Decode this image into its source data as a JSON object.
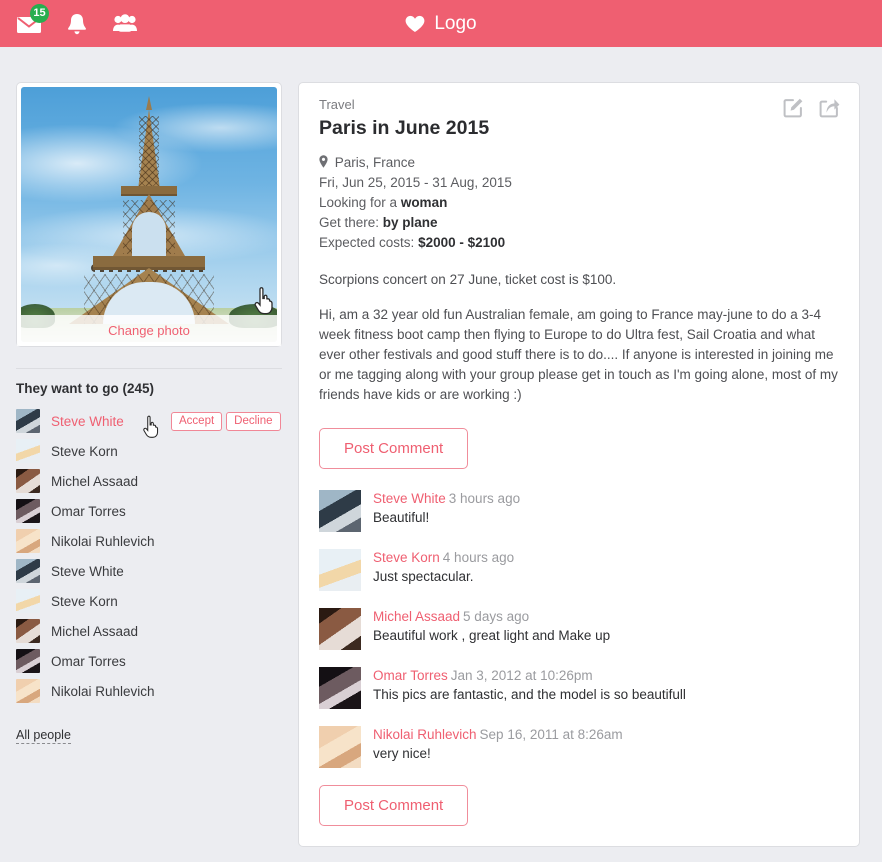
{
  "header": {
    "brand_text": "Logo",
    "brand_icon": "heart-icon",
    "mail_icon": "envelope-icon",
    "mail_badge": "15",
    "bell_icon": "bell-icon",
    "people_icon": "people-group-icon",
    "bg_color": "#ef5f71"
  },
  "sidebar": {
    "photo": {
      "alt_subject": "eiffel-tower-photo",
      "change_photo_label": "Change photo",
      "cursor": "hand-pointer-cursor"
    },
    "people_title": "They want to go (245)",
    "people_count": 245,
    "people": [
      {
        "name": "Steve White",
        "avatar": "av-a",
        "active": true,
        "accept_label": "Accept",
        "decline_label": "Decline"
      },
      {
        "name": "Steve Korn",
        "avatar": "av-b",
        "active": false
      },
      {
        "name": "Michel Assaad",
        "avatar": "av-c",
        "active": false
      },
      {
        "name": "Omar Torres",
        "avatar": "av-d",
        "active": false
      },
      {
        "name": "Nikolai Ruhlevich",
        "avatar": "av-e",
        "active": false
      },
      {
        "name": "Steve White",
        "avatar": "av-a",
        "active": false
      },
      {
        "name": "Steve Korn",
        "avatar": "av-b",
        "active": false
      },
      {
        "name": "Michel Assaad",
        "avatar": "av-c",
        "active": false
      },
      {
        "name": "Omar Torres",
        "avatar": "av-d",
        "active": false
      },
      {
        "name": "Nikolai Ruhlevich",
        "avatar": "av-e",
        "active": false
      }
    ],
    "all_people_label": "All people"
  },
  "post": {
    "category": "Travel",
    "title": "Paris in June 2015",
    "edit_icon": "edit-pencil-icon",
    "share_icon": "share-arrow-icon",
    "location_icon": "map-pin-icon",
    "location": "Paris, France",
    "dates": "Fri, Jun 25, 2015 - 31 Aug, 2015",
    "looking_for_label": "Looking for a ",
    "looking_for_value": "woman",
    "get_there_label": "Get there: ",
    "get_there_value": "by plane",
    "costs_label": "Expected costs: ",
    "costs_value": "$2000 - $2100",
    "note": "Scorpions concert on 27 June, ticket cost is $100.",
    "body": "Hi, am a 32 year old fun Australian female, am going to France may-june to do a 3-4 week fitness boot camp then flying to Europe to do Ultra fest, Sail Croatia and what ever other festivals and good stuff there is to do.... If anyone is interested in joining me or me tagging along with your group please get in touch as I'm going alone, most of my friends have kids or are working :)",
    "post_comment_label_top": "Post Comment",
    "post_comment_label_bottom": "Post Comment"
  },
  "comments": [
    {
      "author": "Steve White",
      "time": "3 hours ago",
      "text": "Beautiful!",
      "avatar": "av-a"
    },
    {
      "author": "Steve Korn",
      "time": "4 hours ago",
      "text": "Just spectacular.",
      "avatar": "av-b"
    },
    {
      "author": "Michel Assaad",
      "time": "5 days ago",
      "text": "Beautiful work , great light and Make up",
      "avatar": "av-c"
    },
    {
      "author": "Omar Torres",
      "time": "Jan 3, 2012 at 10:26pm",
      "text": "This pics are fantastic, and the model is so beautifull",
      "avatar": "av-d"
    },
    {
      "author": "Nikolai Ruhlevich",
      "time": "Sep 16, 2011 at 8:26am",
      "text": "very nice!",
      "avatar": "av-e"
    }
  ],
  "colors": {
    "accent": "#ef5f71",
    "badge_green": "#27ae4f",
    "page_bg": "#ecedf1",
    "card_border": "#dcdde1",
    "muted_text": "#9a9b9f"
  }
}
